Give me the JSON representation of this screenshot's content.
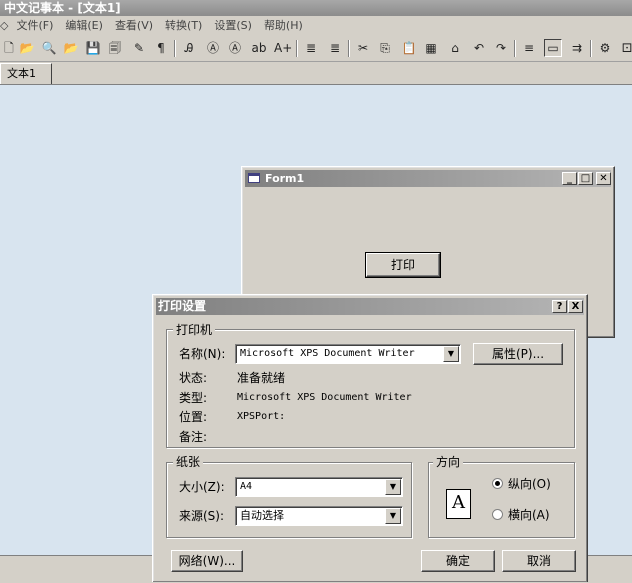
{
  "app": {
    "title": "中文记事本 - [文本1]",
    "title_icon": "app-icon"
  },
  "menu": [
    "文件(F)",
    "编辑(E)",
    "查看(V)",
    "转换(T)",
    "设置(S)",
    "帮助(H)"
  ],
  "toolbar": {
    "icons": [
      "new-doc-icon",
      "open-folder-icon",
      "find-icon",
      "open-icon",
      "save-icon",
      "save-all-icon",
      "edit-icon",
      "paragraph-mark-icon",
      "find-text-icon",
      "replace-icon",
      "find-next-icon",
      "char-icon",
      "convert-icon",
      "indent-icon",
      "outdent-icon",
      "cut-icon",
      "copy-icon",
      "paste-icon",
      "clear-icon",
      "print-icon",
      "undo-icon",
      "redo-icon",
      "align-left-icon",
      "window-icon",
      "wrap-icon",
      "settings-icon",
      "extra-icon"
    ],
    "glyphs": [
      "🗋",
      "📂",
      "🔍",
      "📂",
      "💾",
      "🗐",
      "✎",
      "¶",
      "Ꭿ",
      "Ⓐ",
      "Ⓐ",
      "ab",
      "A+",
      "≣",
      "≣",
      "✂",
      "⎘",
      "📋",
      "▦",
      "⌂",
      "↶",
      "↷",
      "≡",
      "▭",
      "⇉",
      "⚙",
      "⚀"
    ]
  },
  "tabs": [
    {
      "label": "文本1"
    }
  ],
  "form1": {
    "title": "Form1",
    "print_button": "打印",
    "min_icon": "minimize-icon",
    "max_icon": "maximize-icon",
    "close_icon": "close-icon"
  },
  "print_dialog": {
    "title": "打印设置",
    "help_symbol": "?",
    "close_symbol": "X",
    "printer_group": "打印机",
    "name_label": "名称(N):",
    "name_value": "Microsoft XPS Document Writer",
    "properties_button": "属性(P)...",
    "status_label": "状态:",
    "status_value": "准备就绪",
    "type_label": "类型:",
    "type_value": "Microsoft XPS Document Writer",
    "where_label": "位置:",
    "where_value": "XPSPort:",
    "comment_label": "备注:",
    "comment_value": "",
    "paper_group": "纸张",
    "size_label": "大小(Z):",
    "size_value": "A4",
    "source_label": "来源(S):",
    "source_value": "自动选择",
    "orientation_group": "方向",
    "orientation_glyph": "A",
    "portrait_label": "纵向(O)",
    "landscape_label": "横向(A)",
    "orientation_selected": "portrait",
    "network_button": "网络(W)...",
    "ok_button": "确定",
    "cancel_button": "取消"
  }
}
